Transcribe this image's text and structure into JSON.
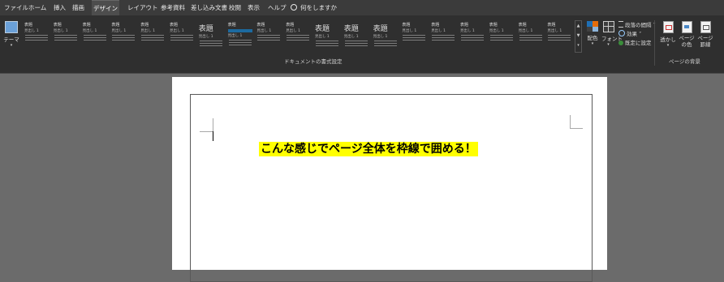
{
  "tabs": [
    {
      "label": "ファイル",
      "active": false
    },
    {
      "label": "ホーム",
      "active": false
    },
    {
      "label": "挿入",
      "active": false
    },
    {
      "label": "描画",
      "active": false
    },
    {
      "label": "デザイン",
      "active": true
    },
    {
      "label": "レイアウト",
      "active": false
    },
    {
      "label": "参考資料",
      "active": false
    },
    {
      "label": "差し込み文書",
      "active": false
    },
    {
      "label": "校閲",
      "active": false
    },
    {
      "label": "表示",
      "active": false
    },
    {
      "label": "ヘルプ",
      "active": false
    }
  ],
  "tell_me": "何をしますか",
  "ribbon": {
    "theme_label": "テーマ",
    "gallery_group_label": "ドキュメントの書式設定",
    "styles": [
      {
        "title": "表題",
        "big": false
      },
      {
        "title": "表題",
        "big": false
      },
      {
        "title": "表題",
        "big": false
      },
      {
        "title": "表題",
        "big": false
      },
      {
        "title": "表題",
        "big": false
      },
      {
        "title": "表題",
        "big": false
      },
      {
        "title": "表題",
        "big": true
      },
      {
        "title": "表題",
        "big": false
      },
      {
        "title": "表題",
        "big": false
      },
      {
        "title": "表題",
        "big": false
      },
      {
        "title": "表題",
        "big": true
      },
      {
        "title": "表題",
        "big": true
      },
      {
        "title": "表題",
        "big": true
      },
      {
        "title": "表題",
        "big": false
      },
      {
        "title": "表題",
        "big": false
      },
      {
        "title": "表題",
        "big": false
      },
      {
        "title": "表題",
        "big": false
      },
      {
        "title": "表題",
        "big": false
      },
      {
        "title": "表題",
        "big": false
      }
    ],
    "heading_text": "見出し 1",
    "colors_label": "配色",
    "fonts_label": "フォント",
    "paragraph_spacing": "段落の間隔 ˅",
    "effects": "効果 ˅",
    "set_default": "既定に設定",
    "watermark_label": "透かし",
    "page_color_label": "ページの色",
    "page_borders_label": "ページ罫線",
    "page_bg_group_label": "ページの背景",
    "colors": {
      "dark": "#2f2f2f",
      "tab_bar": "#3b3b3b",
      "blue": "#1c6aa0",
      "highlight": "#ffff00",
      "canvas": "#6b6b6b"
    }
  },
  "document": {
    "caption": "こんな感じでページ全体を枠線で囲める！"
  }
}
